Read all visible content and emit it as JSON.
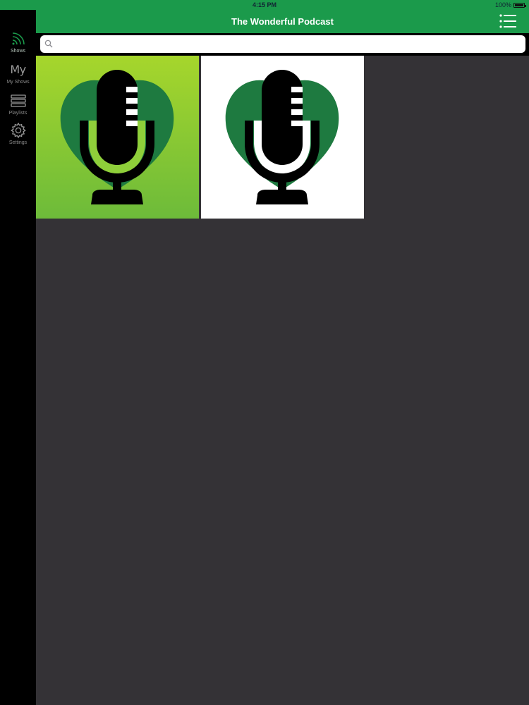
{
  "status_bar": {
    "time": "4:15 PM",
    "battery": "100%"
  },
  "sidebar": {
    "items": [
      {
        "label": "Shows",
        "icon": "rss-feed-icon"
      },
      {
        "label": "My Shows",
        "icon_text": "My",
        "icon": "my-shows-icon"
      },
      {
        "label": "Playlists",
        "icon": "playlists-icon"
      },
      {
        "label": "Settings",
        "icon": "gear-icon"
      }
    ]
  },
  "nav_bar": {
    "title": "The Wonderful Podcast",
    "right_button_icon": "list-icon"
  },
  "search": {
    "placeholder": "",
    "value": ""
  },
  "shows": [
    {
      "artwork": "microphone-heart-logo",
      "background": "green-gradient"
    },
    {
      "artwork": "microphone-heart-logo",
      "background": "white"
    }
  ],
  "colors": {
    "accent": "#1b9a4b",
    "logo_green": "#1e7a40",
    "logo_light": "#8fd03a",
    "content_bg": "#343236"
  }
}
